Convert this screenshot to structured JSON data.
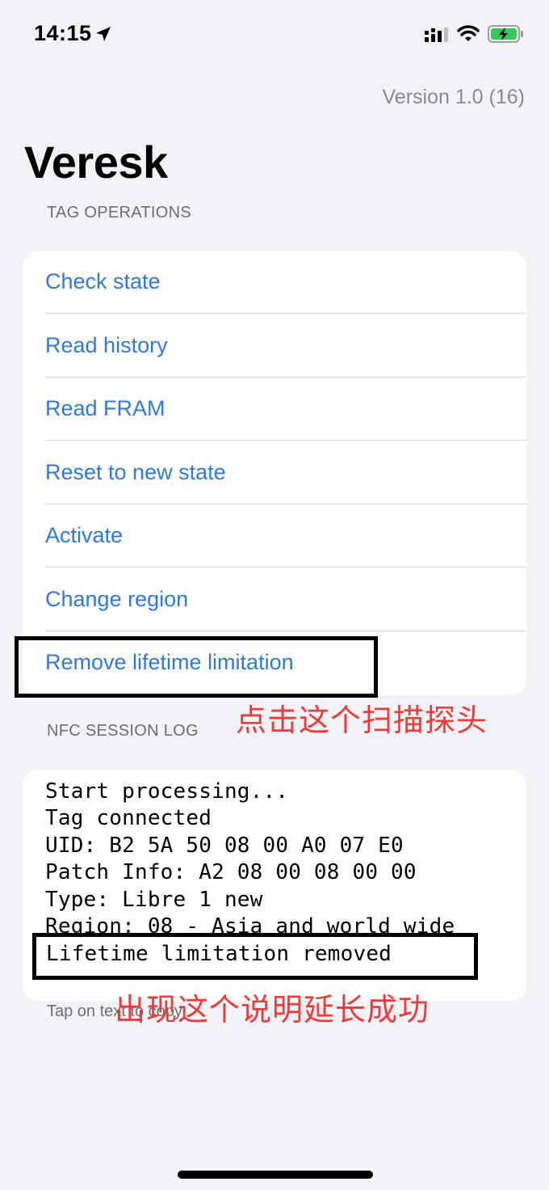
{
  "status_bar": {
    "time": "14:15"
  },
  "header": {
    "version": "Version 1.0 (16)",
    "title": "Veresk"
  },
  "tag_operations": {
    "section_label": "TAG OPERATIONS",
    "items": [
      {
        "label": "Check state"
      },
      {
        "label": "Read history"
      },
      {
        "label": "Read FRAM"
      },
      {
        "label": "Reset to new state"
      },
      {
        "label": "Activate"
      },
      {
        "label": "Change region"
      },
      {
        "label": "Remove lifetime limitation"
      }
    ]
  },
  "annotations": {
    "tap_probe": "点击这个扫描探头",
    "success_note": "出现这个说明延长成功"
  },
  "nfc_log": {
    "section_label": "NFC SESSION LOG",
    "lines": [
      "Start processing...",
      "Tag connected",
      "UID: B2 5A 50 08 00 A0 07 E0",
      "Patch Info: A2 08 00 08 00 00",
      "Type: Libre 1 new",
      "Region: 08 - Asia and world wide",
      "Lifetime limitation removed"
    ],
    "hint": "Tap on text to copy"
  },
  "colors": {
    "accent": "#2f7ad6",
    "annotation": "#ec3b3b",
    "background": "#f2f2f7"
  }
}
